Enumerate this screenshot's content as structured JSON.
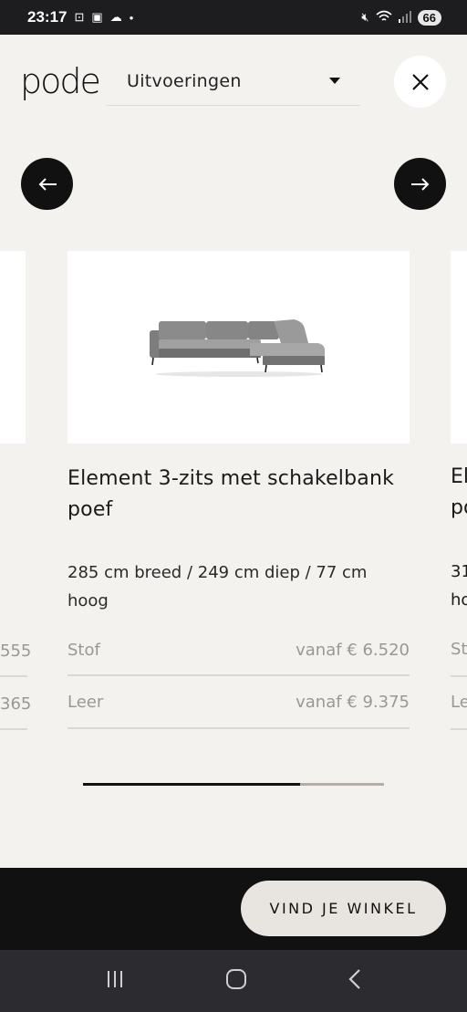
{
  "status_bar": {
    "time": "23:17",
    "battery": "66"
  },
  "header": {
    "logo_text": "pode",
    "variant_select": "Uitvoeringen"
  },
  "product": {
    "title": "Element 3-zits met schakelbank poef",
    "dimensions": "285 cm breed / 249 cm diep / 77 cm hoog",
    "prices": [
      {
        "material": "Stof",
        "price": "vanaf € 6.520"
      },
      {
        "material": "Leer",
        "price": "vanaf € 9.375"
      }
    ]
  },
  "prev_card": {
    "price_fragments": [
      "555",
      "365"
    ]
  },
  "next_card": {
    "title_fragment_1": "El",
    "title_fragment_2": "po",
    "dims_fragment_1": "31",
    "dims_fragment_2": "ho",
    "material_fragments": [
      "St",
      "Le"
    ]
  },
  "carousel": {
    "progress": 0.72
  },
  "cta": {
    "find_store": "VIND JE WINKEL"
  },
  "colors": {
    "background": "#f3f2ef",
    "dark": "#111111",
    "button_light": "#e8e4df"
  }
}
